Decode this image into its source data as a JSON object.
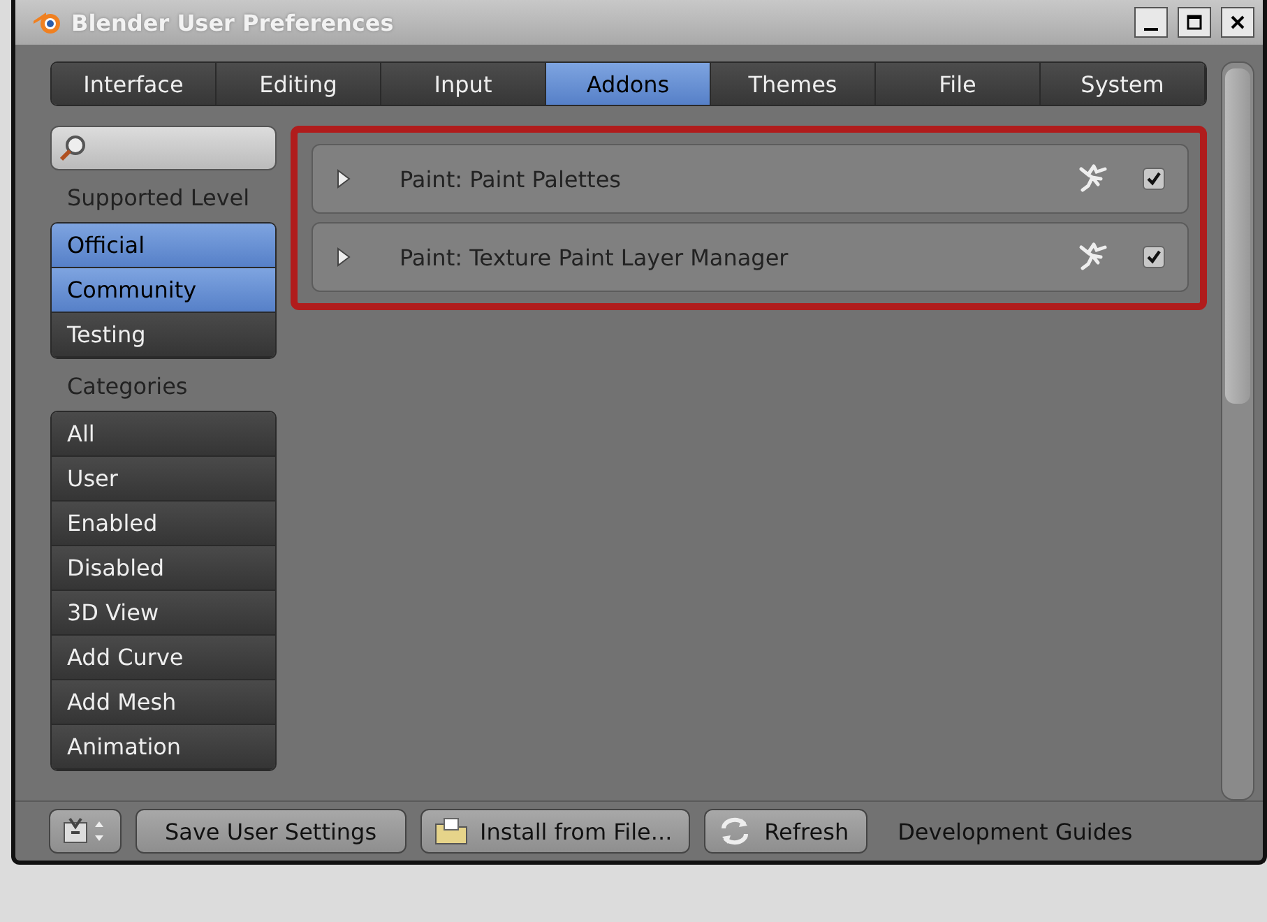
{
  "window": {
    "title": "Blender User Preferences"
  },
  "tabs": [
    {
      "label": "Interface",
      "selected": false
    },
    {
      "label": "Editing",
      "selected": false
    },
    {
      "label": "Input",
      "selected": false
    },
    {
      "label": "Addons",
      "selected": true
    },
    {
      "label": "Themes",
      "selected": false
    },
    {
      "label": "File",
      "selected": false
    },
    {
      "label": "System",
      "selected": false
    }
  ],
  "sidebar": {
    "support_heading": "Supported Level",
    "support_levels": [
      {
        "label": "Official",
        "selected": true
      },
      {
        "label": "Community",
        "selected": true
      },
      {
        "label": "Testing",
        "selected": false
      }
    ],
    "categories_heading": "Categories",
    "categories": [
      {
        "label": "All",
        "selected": false
      },
      {
        "label": "User",
        "selected": false
      },
      {
        "label": "Enabled",
        "selected": false
      },
      {
        "label": "Disabled",
        "selected": false
      },
      {
        "label": "3D View",
        "selected": false
      },
      {
        "label": "Add Curve",
        "selected": false
      },
      {
        "label": "Add Mesh",
        "selected": false
      },
      {
        "label": "Animation",
        "selected": false
      }
    ]
  },
  "addons": [
    {
      "name": "Paint: Paint Palettes",
      "expanded": false,
      "checked": true
    },
    {
      "name": "Paint: Texture Paint Layer Manager",
      "expanded": false,
      "checked": true
    }
  ],
  "footer": {
    "buttons": [
      {
        "label": "Save User Settings",
        "kind": "plain"
      },
      {
        "label": "Install from File...",
        "kind": "folder"
      },
      {
        "label": "Refresh",
        "kind": "refresh"
      }
    ],
    "link": "Development Guides"
  }
}
